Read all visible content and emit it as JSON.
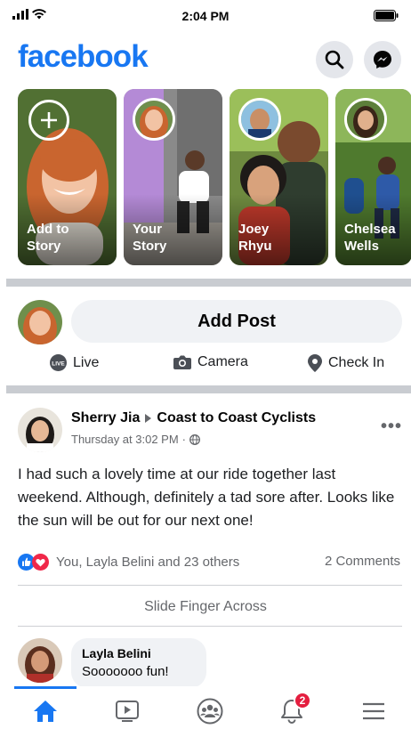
{
  "status_bar": {
    "time": "2:04 PM"
  },
  "header": {
    "logo": "facebook",
    "search_icon": "search-icon",
    "messenger_icon": "messenger-icon"
  },
  "stories": [
    {
      "label": "Add to\nStory",
      "type": "add"
    },
    {
      "label": "Your\nStory"
    },
    {
      "label": "Joey\nRhyu"
    },
    {
      "label": "Chelsea\nWells"
    }
  ],
  "composer": {
    "add_post_label": "Add Post",
    "actions": [
      {
        "label": "Live",
        "icon": "live-icon"
      },
      {
        "label": "Camera",
        "icon": "camera-icon"
      },
      {
        "label": "Check In",
        "icon": "location-pin-icon"
      }
    ]
  },
  "post": {
    "author": "Sherry Jia",
    "group": "Coast to Coast Cyclists",
    "timestamp": "Thursday at 3:02 PM",
    "privacy_icon": "globe-icon",
    "text": "I had such a lovely time at our ride together last weekend. Although, definitely a tad sore after. Looks like the sun will be out for our next one!",
    "reactions_text": "You, Layla Belini and 23 others",
    "comments_count": "2 Comments",
    "slide_hint": "Slide Finger Across",
    "comment": {
      "name": "Layla Belini",
      "text": "Sooooooo fun!"
    }
  },
  "bottom_nav": {
    "items": [
      "home-icon",
      "watch-icon",
      "groups-icon",
      "notifications-icon",
      "menu-icon"
    ],
    "active": "home-icon",
    "notification_badge": "2"
  },
  "colors": {
    "brand": "#1877f2",
    "badge": "#e41e3f",
    "divider": "#c9ccd1"
  }
}
